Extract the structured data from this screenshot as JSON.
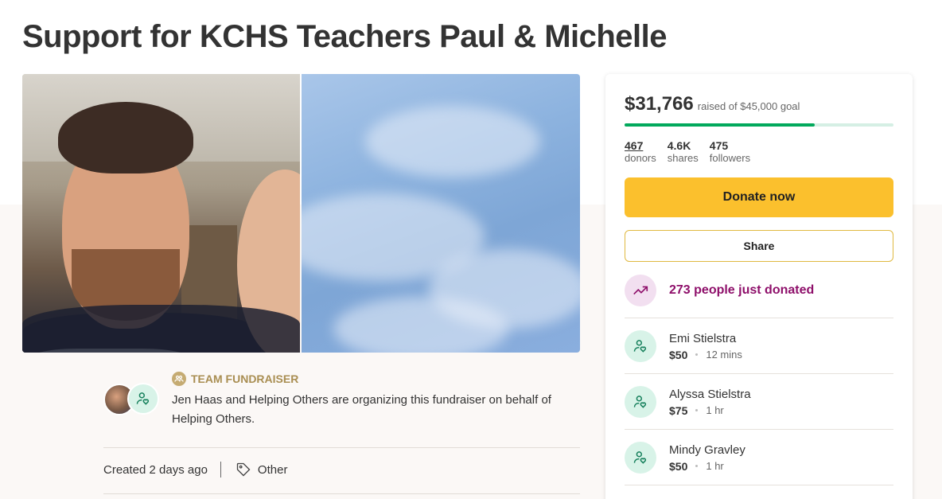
{
  "campaign": {
    "title": "Support for KCHS Teachers Paul & Michelle"
  },
  "organizer": {
    "badge": "TEAM FUNDRAISER",
    "description": "Jen Haas and Helping Others are organizing this fundraiser on behalf of Helping Others."
  },
  "meta": {
    "created": "Created 2 days ago",
    "category": "Other"
  },
  "progress": {
    "raised": "$31,766",
    "goal_text": "raised of $45,000 goal",
    "fraction": 0.706
  },
  "stats": [
    {
      "value": "467",
      "label": "donors"
    },
    {
      "value": "4.6K",
      "label": "shares"
    },
    {
      "value": "475",
      "label": "followers"
    }
  ],
  "buttons": {
    "donate": "Donate now",
    "share": "Share"
  },
  "recent": {
    "text": "273 people just donated"
  },
  "donations": [
    {
      "name": "Emi Stielstra",
      "amount": "$50",
      "time": "12 mins"
    },
    {
      "name": "Alyssa Stielstra",
      "amount": "$75",
      "time": "1 hr"
    },
    {
      "name": "Mindy Gravley",
      "amount": "$50",
      "time": "1 hr"
    }
  ],
  "colors": {
    "accent_green": "#02a95c",
    "donate_yellow": "#fbc02d",
    "trend_purple": "#8e0f6a"
  }
}
